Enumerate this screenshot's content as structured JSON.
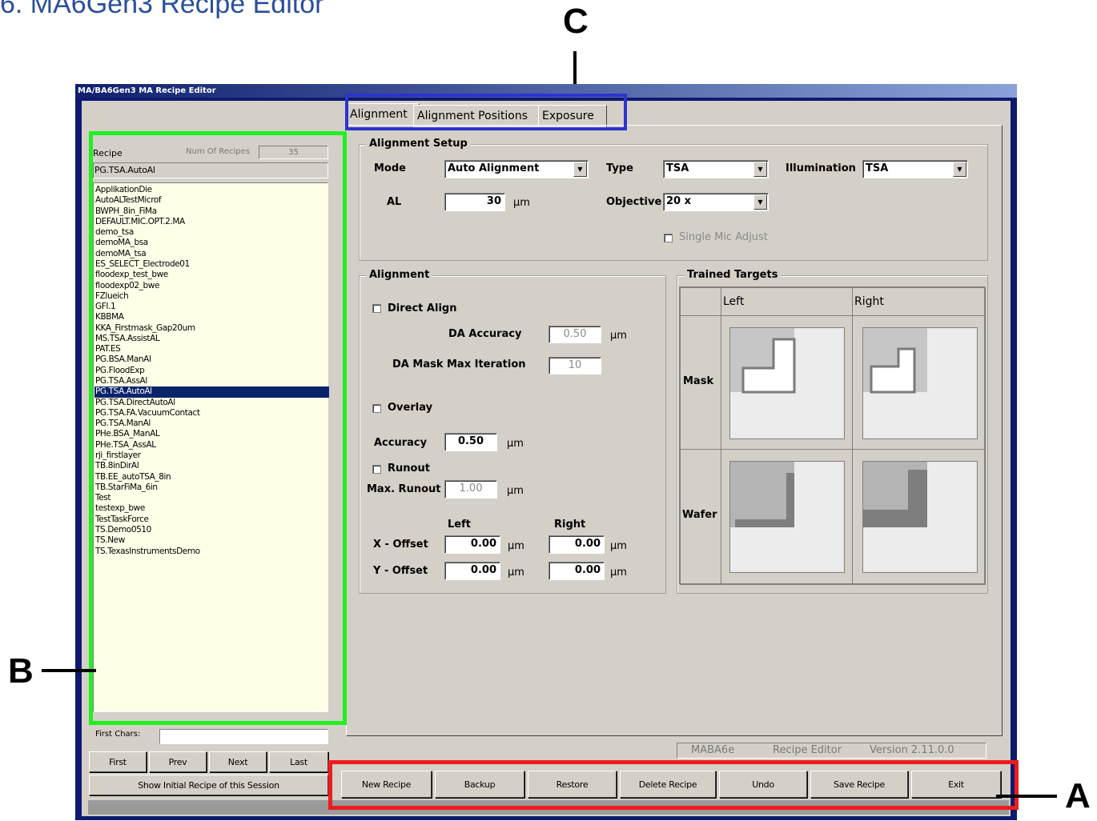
{
  "page_heading": "6. MA6Gen3 Recipe Editor",
  "callouts": {
    "a": "A",
    "b": "B",
    "c": "C"
  },
  "window": {
    "title": "MA/BA6Gen3 MA Recipe Editor"
  },
  "recipe_panel": {
    "recipe_label": "Recipe",
    "num_recipes_label": "Num Of Recipes",
    "num_recipes_value": "35",
    "current_recipe": "PG.TSA.AutoAl",
    "items": [
      "ApplikationDie",
      "AutoALTestMicrof",
      "BWPH_8in_FiMa",
      "DEFAULT.MIC.OPT.2.MA",
      "demo_tsa",
      "demoMA_bsa",
      "demoMA_tsa",
      "ES_SELECT_Electrode01",
      "floodexp_test_bwe",
      "floodexp02_bwe",
      "FZlueich",
      "GFI.1",
      "KBBMA",
      "KKA_Firstmask_Gap20um",
      "MS.TSA.AssistAL",
      "PAT.ES",
      "PG.BSA.ManAl",
      "PG.FloodExp",
      "PG.TSA.AssAl",
      "PG.TSA.AutoAl",
      "PG.TSA.DirectAutoAl",
      "PG.TSA.FA.VacuumContact",
      "PG.TSA.ManAl",
      "PHe.BSA_ManAL",
      "PHe.TSA_AssAL",
      "rji_firstlayer",
      "TB.8inDirAl",
      "TB.EE_autoTSA_8in",
      "TB.StarFiMa_6in",
      "Test",
      "testexp_bwe",
      "TestTaskForce",
      "TS.Demo0510",
      "TS.New",
      "TS.TexasInstrumentsDemo"
    ],
    "selected_index": 19,
    "first_chars_label": "First Chars:",
    "first_chars_value": "",
    "nav_first": "First",
    "nav_prev": "Prev",
    "nav_next": "Next",
    "nav_last": "Last",
    "show_initial": "Show Initial Recipe of this Session"
  },
  "tabs": [
    "Alignment",
    "Alignment Positions",
    "Exposure"
  ],
  "alignment_setup": {
    "title": "Alignment Setup",
    "mode_label": "Mode",
    "mode_value": "Auto Alignment",
    "type_label": "Type",
    "type_value": "TSA",
    "illum_label": "Illumination",
    "illum_value": "TSA",
    "al_label": "AL",
    "al_value": "30",
    "al_unit": "µm",
    "objective_label": "Objective",
    "objective_value": "20 x",
    "single_mic_label": "Single Mic Adjust"
  },
  "alignment": {
    "title": "Alignment",
    "direct_align_label": "Direct Align",
    "da_accuracy_label": "DA Accuracy",
    "da_accuracy_value": "0.50",
    "da_accuracy_unit": "µm",
    "da_mask_label": "DA Mask Max Iteration",
    "da_mask_value": "10",
    "overlay_label": "Overlay",
    "accuracy_label": "Accuracy",
    "accuracy_value": "0.50",
    "accuracy_unit": "µm",
    "runout_label": "Runout",
    "max_runout_label": "Max. Runout",
    "max_runout_value": "1.00",
    "max_runout_unit": "µm",
    "left_header": "Left",
    "right_header": "Right",
    "x_offset_label": "X - Offset",
    "x_left": "0.00",
    "x_right": "0.00",
    "y_offset_label": "Y - Offset",
    "y_left": "0.00",
    "y_right": "0.00",
    "unit": "µm"
  },
  "trained_targets": {
    "title": "Trained Targets",
    "col_left": "Left",
    "col_right": "Right",
    "row_mask": "Mask",
    "row_wafer": "Wafer"
  },
  "status": {
    "product": "MABA6e",
    "app": "Recipe Editor",
    "version": "Version 2.11.0.0"
  },
  "buttons": [
    "New Recipe",
    "Backup",
    "Restore",
    "Delete Recipe",
    "Undo",
    "Save Recipe",
    "Exit"
  ],
  "colors": {
    "highlight_green": "#21ef21",
    "highlight_blue": "#2b34cf",
    "highlight_red": "#ee1c1c",
    "window_frame": "#0e1a6e",
    "selection": "#0a246a",
    "heading": "#2a4e9e"
  }
}
